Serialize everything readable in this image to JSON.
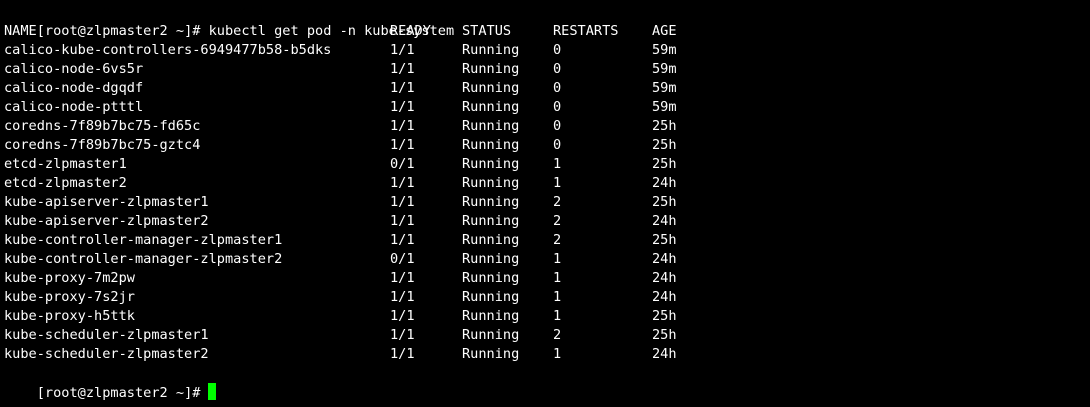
{
  "terminal": {
    "prompt": "[root@zlpmaster2 ~]#",
    "command": " kubectl get pod -n kube-system",
    "colors": {
      "background": "#000000",
      "foreground": "#ffffff",
      "cursor": "#00ff00"
    },
    "table": {
      "headers": [
        "NAME",
        "READY",
        "STATUS",
        "RESTARTS",
        "AGE"
      ],
      "rows": [
        [
          "calico-kube-controllers-6949477b58-b5dks",
          "1/1",
          "Running",
          "0",
          "59m"
        ],
        [
          "calico-node-6vs5r",
          "1/1",
          "Running",
          "0",
          "59m"
        ],
        [
          "calico-node-dgqdf",
          "1/1",
          "Running",
          "0",
          "59m"
        ],
        [
          "calico-node-ptttl",
          "1/1",
          "Running",
          "0",
          "59m"
        ],
        [
          "coredns-7f89b7bc75-fd65c",
          "1/1",
          "Running",
          "0",
          "25h"
        ],
        [
          "coredns-7f89b7bc75-gztc4",
          "1/1",
          "Running",
          "0",
          "25h"
        ],
        [
          "etcd-zlpmaster1",
          "0/1",
          "Running",
          "1",
          "25h"
        ],
        [
          "etcd-zlpmaster2",
          "1/1",
          "Running",
          "1",
          "24h"
        ],
        [
          "kube-apiserver-zlpmaster1",
          "1/1",
          "Running",
          "2",
          "25h"
        ],
        [
          "kube-apiserver-zlpmaster2",
          "1/1",
          "Running",
          "2",
          "24h"
        ],
        [
          "kube-controller-manager-zlpmaster1",
          "1/1",
          "Running",
          "2",
          "25h"
        ],
        [
          "kube-controller-manager-zlpmaster2",
          "0/1",
          "Running",
          "1",
          "24h"
        ],
        [
          "kube-proxy-7m2pw",
          "1/1",
          "Running",
          "1",
          "24h"
        ],
        [
          "kube-proxy-7s2jr",
          "1/1",
          "Running",
          "1",
          "24h"
        ],
        [
          "kube-proxy-h5ttk",
          "1/1",
          "Running",
          "1",
          "25h"
        ],
        [
          "kube-scheduler-zlpmaster1",
          "1/1",
          "Running",
          "2",
          "25h"
        ],
        [
          "kube-scheduler-zlpmaster2",
          "1/1",
          "Running",
          "1",
          "24h"
        ]
      ]
    },
    "final_prompt": "[root@zlpmaster2 ~]#"
  }
}
